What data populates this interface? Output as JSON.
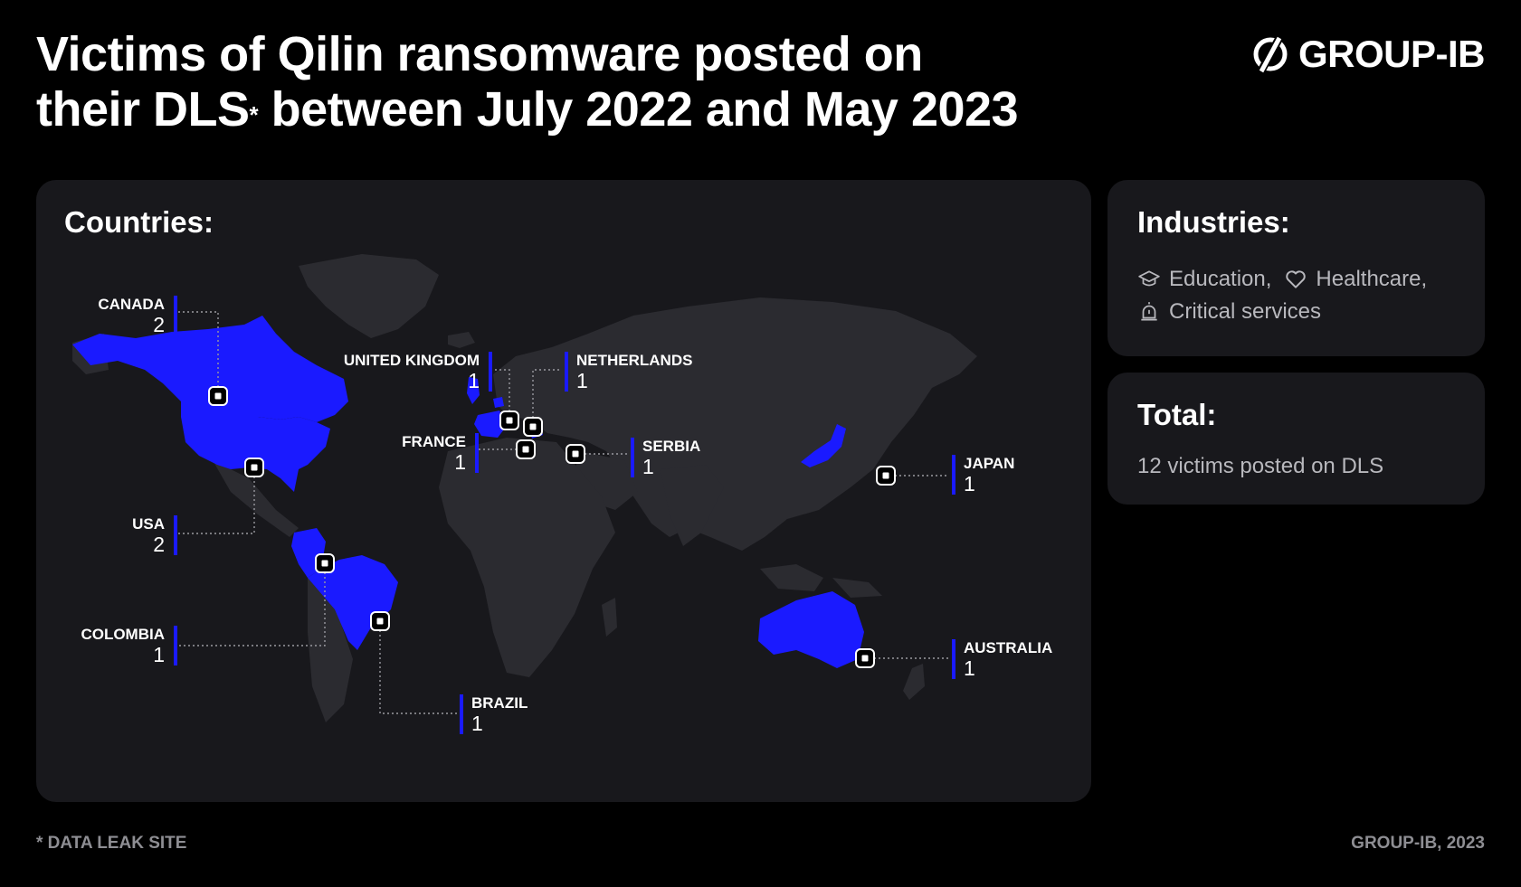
{
  "header": {
    "title_line1": "Victims of Qilin ransomware posted on",
    "title_line2_a": "their DLS",
    "title_sup": "*",
    "title_line2_b": " between July 2022 and May 2023",
    "logo_text": "GROUP-IB"
  },
  "map": {
    "heading": "Countries:",
    "highlight_color": "#1a1aff",
    "land_color": "#2b2b30",
    "markers": [
      {
        "name": "CANADA",
        "count": "2"
      },
      {
        "name": "USA",
        "count": "2"
      },
      {
        "name": "COLOMBIA",
        "count": "1"
      },
      {
        "name": "BRAZIL",
        "count": "1"
      },
      {
        "name": "UNITED KINGDOM",
        "count": "1"
      },
      {
        "name": "NETHERLANDS",
        "count": "1"
      },
      {
        "name": "FRANCE",
        "count": "1"
      },
      {
        "name": "SERBIA",
        "count": "1"
      },
      {
        "name": "JAPAN",
        "count": "1"
      },
      {
        "name": "AUSTRALIA",
        "count": "1"
      }
    ]
  },
  "industries": {
    "heading": "Industries:",
    "items": [
      {
        "label": "Education,",
        "icon": "graduation-cap-icon"
      },
      {
        "label": "Healthcare,",
        "icon": "heart-icon"
      },
      {
        "label": "Critical services",
        "icon": "alarm-bell-icon"
      }
    ]
  },
  "total": {
    "heading": "Total:",
    "text": "12 victims posted on DLS"
  },
  "footer": {
    "footnote": "* DATA LEAK SITE",
    "credit": "GROUP-IB, 2023"
  }
}
